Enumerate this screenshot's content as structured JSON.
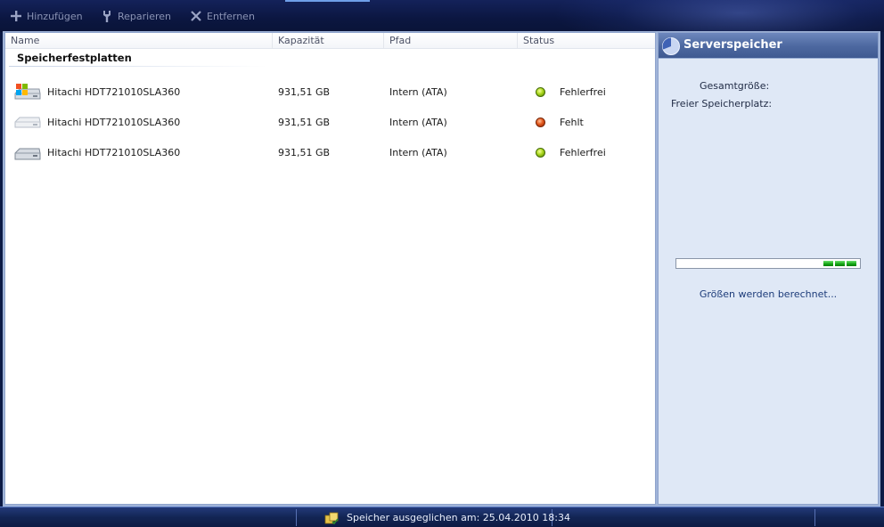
{
  "toolbar": {
    "add_label": "Hinzufügen",
    "repair_label": "Reparieren",
    "remove_label": "Entfernen"
  },
  "columns": {
    "name": "Name",
    "capacity": "Kapazität",
    "path": "Pfad",
    "status": "Status"
  },
  "group": {
    "title": "Speicherfestplatten"
  },
  "disks": [
    {
      "name": "Hitachi HDT721010SLA360",
      "capacity": "931,51 GB",
      "path": "Intern (ATA)",
      "status": "Fehlerfrei",
      "status_color": "#a9d61c",
      "icon": "system-disk-icon"
    },
    {
      "name": "Hitachi HDT721010SLA360",
      "capacity": "931,51 GB",
      "path": "Intern (ATA)",
      "status": "Fehlt",
      "status_color": "#e2571c",
      "icon": "missing-disk-icon"
    },
    {
      "name": "Hitachi HDT721010SLA360",
      "capacity": "931,51 GB",
      "path": "Intern (ATA)",
      "status": "Fehlerfrei",
      "status_color": "#a9d61c",
      "icon": "disk-icon"
    }
  ],
  "side": {
    "title": "Serverspeicher",
    "total_label": "Gesamtgröße:",
    "free_label": "Freier Speicherplatz:",
    "computing_text": "Größen werden berechnet..."
  },
  "statusbar": {
    "text": "Speicher ausgeglichen am: 25.04.2010 18:34"
  }
}
